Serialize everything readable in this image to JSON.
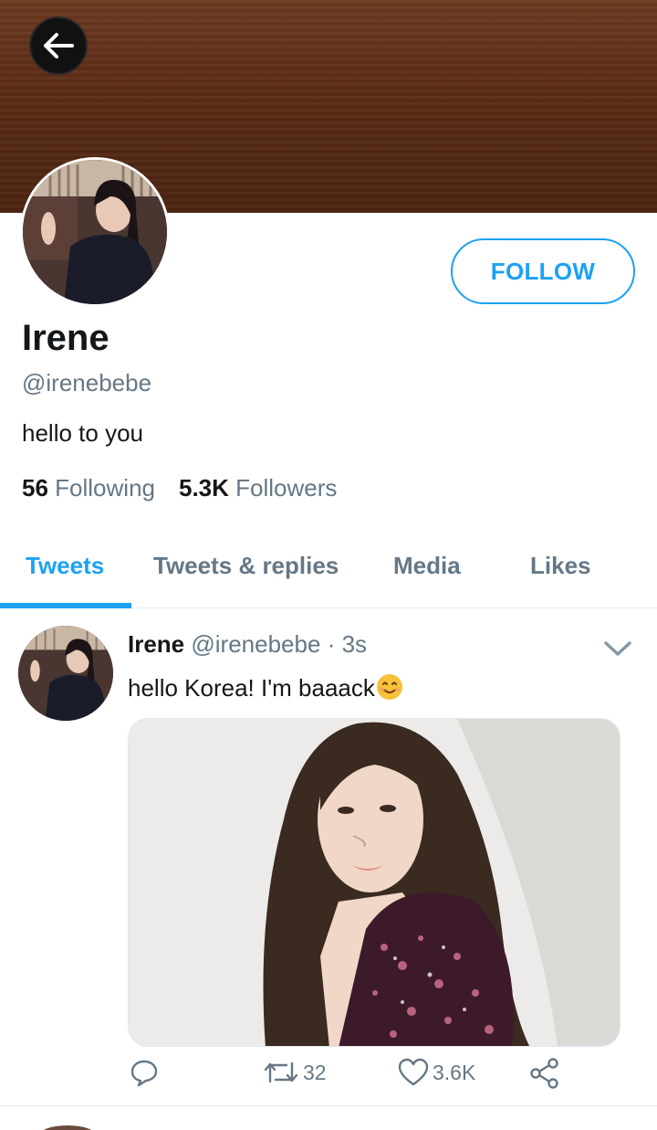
{
  "profile": {
    "name": "Irene",
    "handle": "@irenebebe",
    "bio": "hello to you",
    "following_count": "56",
    "following_label": "Following",
    "followers_count": "5.3K",
    "followers_label": "Followers",
    "follow_button": "FOLLOW"
  },
  "tabs": [
    {
      "label": "Tweets"
    },
    {
      "label": "Tweets & replies"
    },
    {
      "label": "Media"
    },
    {
      "label": "Likes"
    }
  ],
  "tweet": {
    "name": "Irene",
    "handle": "@irenebebe",
    "separator": "·",
    "time": "3s",
    "text": "hello Korea! I'm baaack",
    "emoji": "smiling-face-emoji",
    "retweets": "32",
    "likes": "3.6K"
  },
  "icons": {
    "back": "arrow-left-icon",
    "menu": "chevron-down-icon",
    "reply": "reply-bubble-icon",
    "retweet": "retweet-icon",
    "like": "heart-icon",
    "share": "share-icon"
  },
  "colors": {
    "accent": "#1da1f2",
    "secondary_text": "#657786",
    "banner": "#5a2c16"
  }
}
